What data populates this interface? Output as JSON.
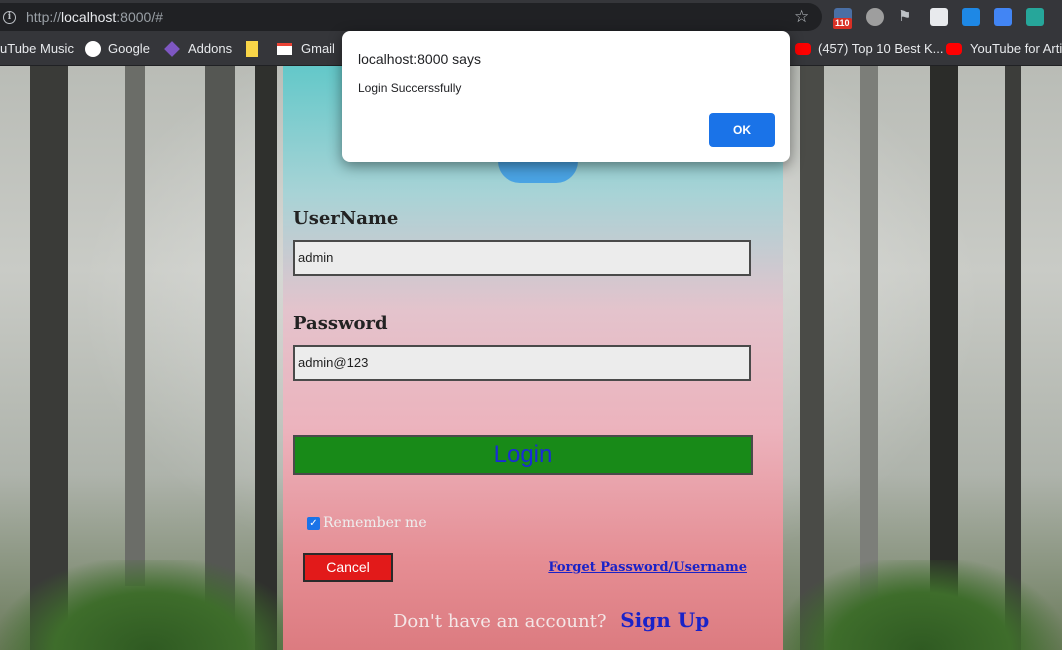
{
  "browser": {
    "url_prefix": "http://",
    "url_host": "localhost",
    "url_rest": ":8000/#",
    "extension_badge": "110",
    "bookmarks": [
      {
        "label": "uTube Music"
      },
      {
        "label": "Google"
      },
      {
        "label": "Addons"
      },
      {
        "label": "Gmail"
      },
      {
        "label": "(457) Top 10 Best K..."
      },
      {
        "label": "YouTube for Artis"
      }
    ]
  },
  "dialog": {
    "title": "localhost:8000 says",
    "message": "Login Succerssfully",
    "ok_label": "OK"
  },
  "form": {
    "username_label": "UserName",
    "username_value": "admin",
    "password_label": "Password",
    "password_value": "admin@123",
    "login_label": "Login",
    "remember_label": "Remember me",
    "remember_checked": true,
    "cancel_label": "Cancel",
    "forget_label": "Forget Password/Username",
    "no_account_text": "Don't have an account?",
    "signup_label": "Sign Up"
  },
  "colors": {
    "login_button": "#188a18",
    "cancel_button": "#e21a1a",
    "link": "#1a22c8",
    "dialog_ok": "#1a73e8"
  }
}
